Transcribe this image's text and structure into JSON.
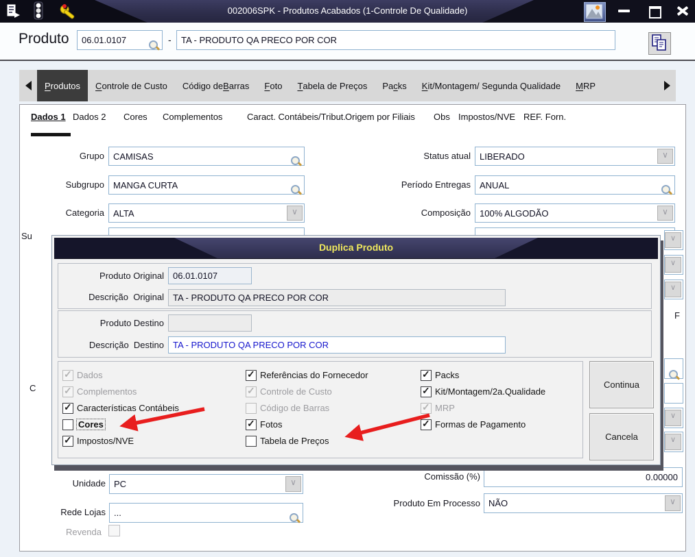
{
  "window": {
    "title": "002006SPK - Produtos Acabados (1-Controle De Qualidade)",
    "left_icons": [
      "export-icon",
      "traffic-light-icon",
      "wrench-icon"
    ],
    "right_icons": [
      "picture-icon",
      "minimize-icon",
      "maximize-icon",
      "close-icon"
    ]
  },
  "header": {
    "product_label": "Produto",
    "code": "06.01.0107",
    "dash": "-",
    "description": "TA - PRODUTO QA PRECO POR COR",
    "copy_icon": "copy-icon"
  },
  "tabs": {
    "items": [
      {
        "label": "Produtos",
        "underline": 0,
        "selected": true
      },
      {
        "label": "Controle de Custo",
        "underline": 0,
        "selected": false
      },
      {
        "label": "Código de Barras",
        "underline": 10,
        "selected": false
      },
      {
        "label": "Foto",
        "underline": 0,
        "selected": false
      },
      {
        "label": "Tabela de Preços",
        "underline": 0,
        "selected": false
      },
      {
        "label": "Packs",
        "underline": 2,
        "selected": false
      },
      {
        "label": "Kit/Montagem/ Segunda Qualidade",
        "underline": 0,
        "selected": false
      },
      {
        "label": "MRP",
        "underline": 0,
        "selected": false
      }
    ]
  },
  "subtabs": {
    "items": [
      {
        "label": "Dados 1",
        "selected": true
      },
      {
        "label": "Dados 2",
        "selected": false
      },
      {
        "label": "Cores",
        "selected": false
      },
      {
        "label": "Complementos",
        "selected": false
      },
      {
        "label": "Caract. Contábeis/Tribut.",
        "selected": false
      },
      {
        "label": "Origem por Filiais",
        "selected": false
      },
      {
        "label": "Obs",
        "selected": false
      },
      {
        "label": "Impostos/NVE",
        "selected": false
      },
      {
        "label": "REF. Forn.",
        "selected": false
      }
    ]
  },
  "form": {
    "grupo": {
      "label": "Grupo",
      "value": "CAMISAS"
    },
    "subgrupo": {
      "label": "Subgrupo",
      "value": "MANGA CURTA"
    },
    "categoria": {
      "label": "Categoria",
      "value": "ALTA"
    },
    "status_atual": {
      "label": "Status atual",
      "value": "LIBERADO"
    },
    "periodo_entregas": {
      "label": "Período Entregas",
      "value": "ANUAL"
    },
    "composicao": {
      "label": "Composição",
      "value": "100% ALGODÃO"
    },
    "unidade": {
      "label": "Unidade",
      "value": "PC"
    },
    "rede_lojas": {
      "label": "Rede Lojas",
      "value": "..."
    },
    "revenda": {
      "label": "Revenda"
    },
    "comissao": {
      "label": "Comissão (%)",
      "value": "0.00000"
    },
    "produto_em_processo": {
      "label": "Produto Em Processo",
      "value": "NÃO"
    }
  },
  "partials": {
    "su": "Su",
    "c": "C",
    "f": "F"
  },
  "dialog": {
    "title": "Duplica Produto",
    "produto_original": {
      "label": "Produto Original",
      "value": "06.01.0107"
    },
    "descricao_original": {
      "label": "Descrição  Original",
      "value": "TA - PRODUTO QA PRECO POR COR"
    },
    "produto_destino": {
      "label": "Produto Destino",
      "value": ""
    },
    "descricao_destino": {
      "label": "Descrição  Destino",
      "value": "TA - PRODUTO QA PRECO POR COR"
    },
    "checkbox_columns": [
      [
        {
          "label": "Dados",
          "checked": true,
          "disabled": true
        },
        {
          "label": "Complementos",
          "checked": true,
          "disabled": true
        },
        {
          "label": "Características Contábeis",
          "checked": true,
          "disabled": false
        },
        {
          "label": "Cores",
          "checked": false,
          "disabled": false,
          "focused": true
        },
        {
          "label": "Impostos/NVE",
          "checked": true,
          "disabled": false
        }
      ],
      [
        {
          "label": "Referências do Fornecedor",
          "checked": true,
          "disabled": false
        },
        {
          "label": "Controle de Custo",
          "checked": true,
          "disabled": true
        },
        {
          "label": "Código de Barras",
          "checked": false,
          "disabled": true
        },
        {
          "label": "Fotos",
          "checked": true,
          "disabled": false
        },
        {
          "label": "Tabela de Preços",
          "checked": false,
          "disabled": false
        }
      ],
      [
        {
          "label": "Packs",
          "checked": true,
          "disabled": false
        },
        {
          "label": "Kit/Montagem/2a.Qualidade",
          "checked": true,
          "disabled": false
        },
        {
          "label": "MRP",
          "checked": true,
          "disabled": true
        },
        {
          "label": "Formas de Pagamento",
          "checked": true,
          "disabled": false
        }
      ]
    ],
    "buttons": {
      "continua": "Continua",
      "cancela": "Cancela"
    }
  },
  "colors": {
    "titlebar_navy": "#2e2e4c",
    "dialog_title_yellow": "#f0e95e",
    "arrow_red": "#e81e1e",
    "field_border_blue": "#8fb2d0",
    "selected_tab_bg": "#3c3c3c"
  }
}
